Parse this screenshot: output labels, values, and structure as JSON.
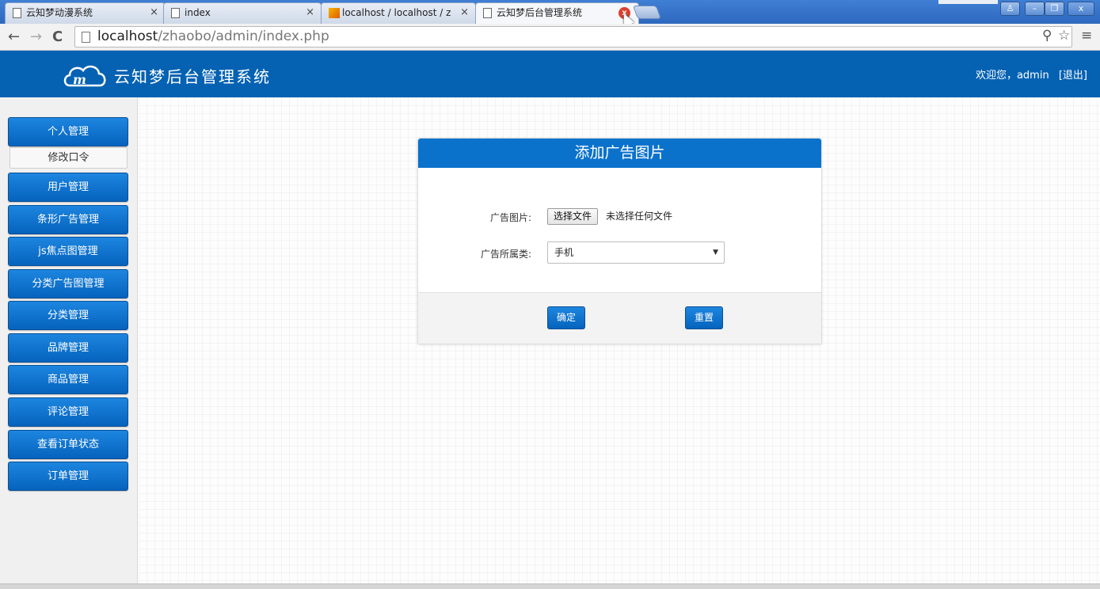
{
  "browser": {
    "tabs": [
      {
        "title": "云知梦动漫系统",
        "icon": "page-icon",
        "active": false
      },
      {
        "title": "index",
        "icon": "page-icon",
        "active": false
      },
      {
        "title": "localhost / localhost / z",
        "icon": "phpmyadmin-icon",
        "active": false
      },
      {
        "title": "云知梦后台管理系统",
        "icon": "page-icon",
        "active": true
      }
    ],
    "url_host": "localhost",
    "url_path": "/zhaobo/admin/index.php",
    "window_controls": {
      "profile": "♙",
      "minimize": "–",
      "restore": "❐",
      "close": "x"
    }
  },
  "header": {
    "title": "云知梦后台管理系统",
    "welcome": "欢迎您，admin",
    "logout": "[退出]"
  },
  "sidebar": {
    "items": [
      {
        "label": "个人管理"
      },
      {
        "label": "用户管理"
      },
      {
        "label": "条形广告管理"
      },
      {
        "label": "js焦点图管理"
      },
      {
        "label": "分类广告图管理"
      },
      {
        "label": "分类管理"
      },
      {
        "label": "品牌管理"
      },
      {
        "label": "商品管理"
      },
      {
        "label": "评论管理"
      },
      {
        "label": "查看订单状态"
      },
      {
        "label": "订单管理"
      }
    ],
    "sub_item": "修改口令"
  },
  "form": {
    "title": "添加广告图片",
    "image_label": "广告图片:",
    "file_button": "选择文件",
    "file_status": "未选择任何文件",
    "category_label": "广告所属类:",
    "category_value": "手机",
    "submit": "确定",
    "reset": "重置"
  },
  "colors": {
    "header_bg": "#0562b3",
    "button_bg": "#0563bd",
    "panel_title_bg": "#0b72cc"
  }
}
